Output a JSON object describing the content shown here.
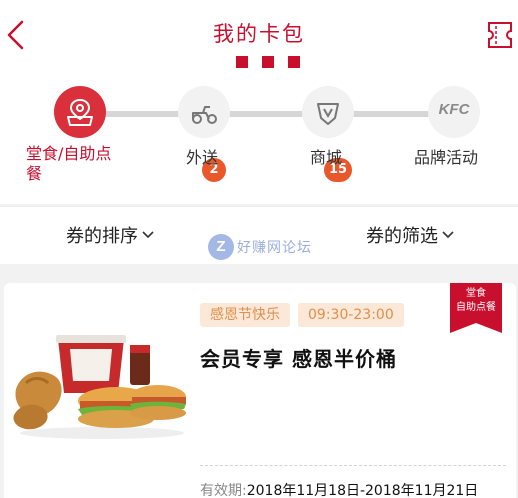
{
  "header": {
    "title": "我的卡包",
    "back_icon": "chevron-left-icon",
    "coupon_icon": "ticket-icon"
  },
  "tabs": [
    {
      "label": "堂食/自助点\n餐",
      "icon": "dine-in-icon",
      "active": true,
      "badge": ""
    },
    {
      "label": "外送",
      "icon": "delivery-scooter-icon",
      "active": false,
      "badge": "2"
    },
    {
      "label": "商城",
      "icon": "shop-icon",
      "active": false,
      "badge": "15"
    },
    {
      "label": "品牌活动",
      "icon": "kfc-logo-icon",
      "logo_text": "KFC",
      "active": false,
      "badge": ""
    }
  ],
  "sortbar": {
    "sort_label": "券的排序",
    "filter_label": "券的筛选"
  },
  "watermark": {
    "icon_text": "Z",
    "text": "好赚网论坛"
  },
  "coupon": {
    "tags": [
      "感恩节快乐",
      "09:30-23:00"
    ],
    "title": "会员专享 感恩半价桶",
    "corner_label_line1": "堂食",
    "corner_label_line2": "自助点餐",
    "validity_label": "有效期:",
    "validity_value": "2018年11月18日-2018年11月21日"
  },
  "colors": {
    "accent": "#c8102e",
    "badge": "#e8582a",
    "chip_bg": "#fbe8d8",
    "chip_text": "#e0904a",
    "inactive_circle": "#f2f2f2"
  }
}
